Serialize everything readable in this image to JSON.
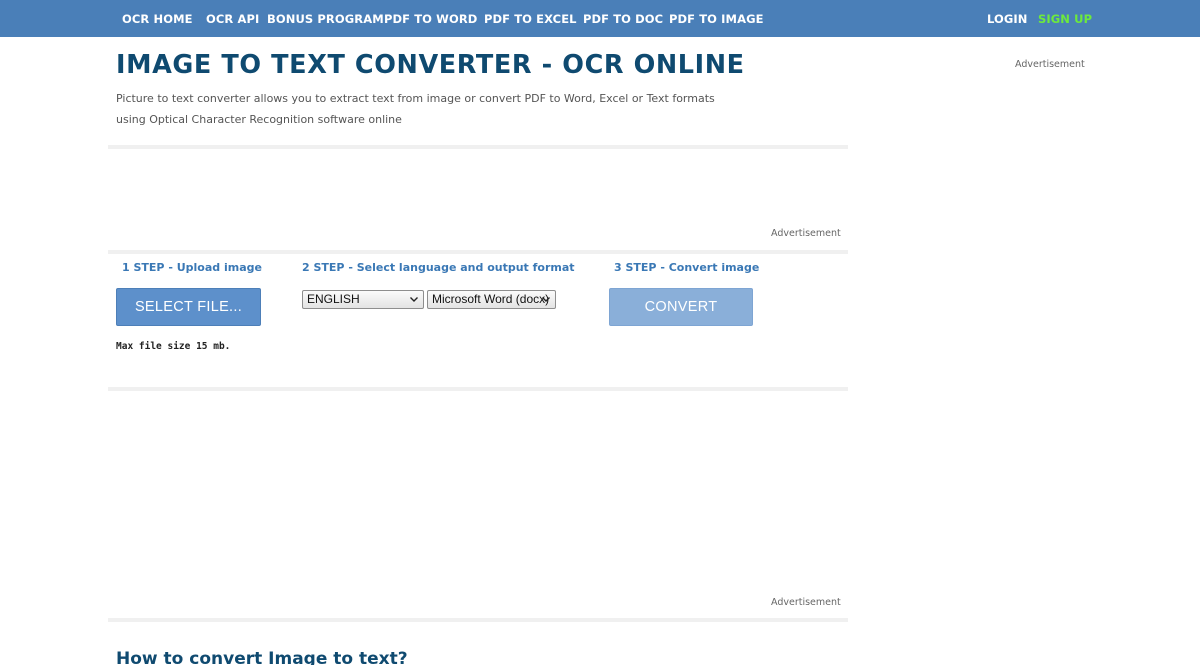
{
  "nav": {
    "links": [
      "OCR HOME",
      "OCR API",
      "BONUS PROGRAM",
      "PDF TO WORD",
      "PDF TO EXCEL",
      "PDF TO DOC",
      "PDF TO IMAGE"
    ],
    "login": "LOGIN",
    "signup": "SIGN UP"
  },
  "page": {
    "title": "IMAGE TO TEXT CONVERTER - OCR ONLINE",
    "intro_line1": "Picture to text converter allows you to extract text from image or convert PDF to Word, Excel or Text formats",
    "intro_line2": "using Optical Character Recognition software online"
  },
  "ads": {
    "label": "Advertisement"
  },
  "steps": {
    "step1": "1 STEP - Upload image",
    "step2": "2 STEP - Select language and output format",
    "step3": "3 STEP - Convert image"
  },
  "upload": {
    "button_label": "SELECT FILE...",
    "max_size_note": "Max file size 15 mb."
  },
  "options": {
    "language_selected": "ENGLISH",
    "format_selected": "Microsoft Word (docx)"
  },
  "convert": {
    "button_label": "CONVERT"
  },
  "howto": {
    "title": "How to convert Image to text?"
  },
  "colors": {
    "nav_bg": "#4a7fb8",
    "title": "#0f4a70",
    "step_heading": "#3a78b5",
    "signup": "#6dea3c",
    "select_button": "#5d90cb",
    "convert_button": "#8aafd9"
  }
}
